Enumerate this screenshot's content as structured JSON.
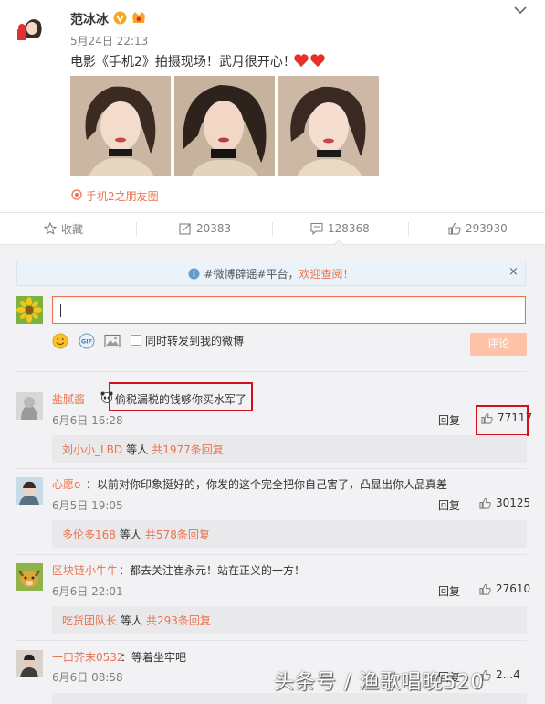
{
  "post": {
    "author": "范冰冰",
    "time": "5月24日 22:13",
    "text": "电影《手机2》拍摄现场！武月很开心！",
    "location": "手机2之朋友圈"
  },
  "actions": {
    "favorite": "收藏",
    "repost_count": "20383",
    "comment_count": "128368",
    "like_count": "293930"
  },
  "notice": {
    "prefix": "#微博辟谣#平台，",
    "link": "欢迎查阅！",
    "close": "×"
  },
  "composer": {
    "also_repost_label": "同时转发到我的微博",
    "submit_label": "评论"
  },
  "comments": [
    {
      "user": "盐腻酱",
      "text": "偷税漏税的钱够你买水军了",
      "time": "6月6日 16:28",
      "reply": "回复",
      "likes": "77117",
      "sub_user": "刘小小_LBD",
      "sub_mid": "等人",
      "sub_count": "共1977条回复"
    },
    {
      "user": "心愿o",
      "text": "：以前对你印象挺好的，你发的这个完全把你自己害了，凸显出你人品真差",
      "time": "6月5日 19:05",
      "reply": "回复",
      "likes": "30125",
      "sub_user": "多伦多168",
      "sub_mid": "等人",
      "sub_count": "共578条回复"
    },
    {
      "user": "区块链小牛牛",
      "text": "：都去关注崔永元！站在正义的一方！",
      "time": "6月6日 22:01",
      "reply": "回复",
      "likes": "27610",
      "sub_user": "吃货团队长",
      "sub_mid": "等人",
      "sub_count": "共293条回复"
    },
    {
      "user": "一口芥末0532",
      "text": "：等着坐牢吧",
      "time": "6月6日 08:58",
      "reply": "回复",
      "likes": "2...4"
    }
  ],
  "watermark": "头条号 / 渔歌唱晚520",
  "colors": {
    "accent": "#eb7350",
    "highlight": "#d0111a",
    "verified": "#f5a623"
  },
  "icons": [
    "v-badge-icon",
    "star-icon",
    "repost-icon",
    "comment-icon",
    "thumb-up-icon",
    "info-icon",
    "smile-icon",
    "gif-icon",
    "image-icon",
    "location-icon",
    "chevron-down-icon"
  ]
}
